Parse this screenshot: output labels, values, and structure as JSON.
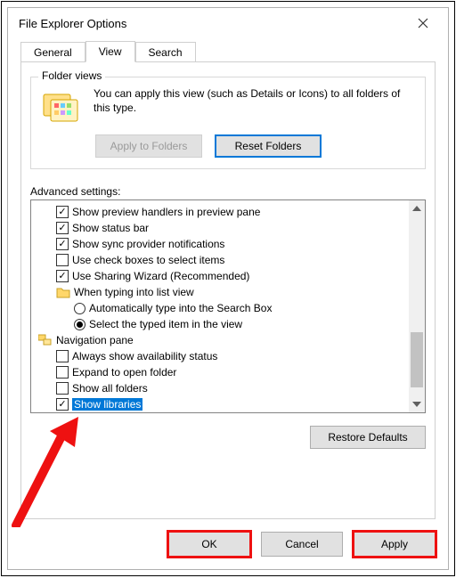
{
  "window": {
    "title": "File Explorer Options"
  },
  "tabs": {
    "general": "General",
    "view": "View",
    "search": "Search"
  },
  "folder_views": {
    "legend": "Folder views",
    "description": "You can apply this view (such as Details or Icons) to all folders of this type.",
    "apply_label": "Apply to Folders",
    "reset_label": "Reset Folders"
  },
  "advanced": {
    "label": "Advanced settings:",
    "items": [
      {
        "type": "check",
        "checked": true,
        "label": "Show preview handlers in preview pane",
        "indent": 1
      },
      {
        "type": "check",
        "checked": true,
        "label": "Show status bar",
        "indent": 1
      },
      {
        "type": "check",
        "checked": true,
        "label": "Show sync provider notifications",
        "indent": 1
      },
      {
        "type": "check",
        "checked": false,
        "label": "Use check boxes to select items",
        "indent": 1
      },
      {
        "type": "check",
        "checked": true,
        "label": "Use Sharing Wizard (Recommended)",
        "indent": 1
      },
      {
        "type": "category",
        "icon": "folder",
        "label": "When typing into list view",
        "indent": 1
      },
      {
        "type": "radio",
        "selected": false,
        "label": "Automatically type into the Search Box",
        "indent": 2
      },
      {
        "type": "radio",
        "selected": true,
        "label": "Select the typed item in the view",
        "indent": 2
      },
      {
        "type": "category",
        "icon": "navpane",
        "label": "Navigation pane",
        "indent": 0
      },
      {
        "type": "check",
        "checked": false,
        "label": "Always show availability status",
        "indent": 1
      },
      {
        "type": "check",
        "checked": false,
        "label": "Expand to open folder",
        "indent": 1
      },
      {
        "type": "check",
        "checked": false,
        "label": "Show all folders",
        "indent": 1
      },
      {
        "type": "check",
        "checked": true,
        "label": "Show libraries",
        "indent": 1,
        "highlighted": true
      }
    ],
    "restore_label": "Restore Defaults"
  },
  "buttons": {
    "ok": "OK",
    "cancel": "Cancel",
    "apply": "Apply"
  }
}
